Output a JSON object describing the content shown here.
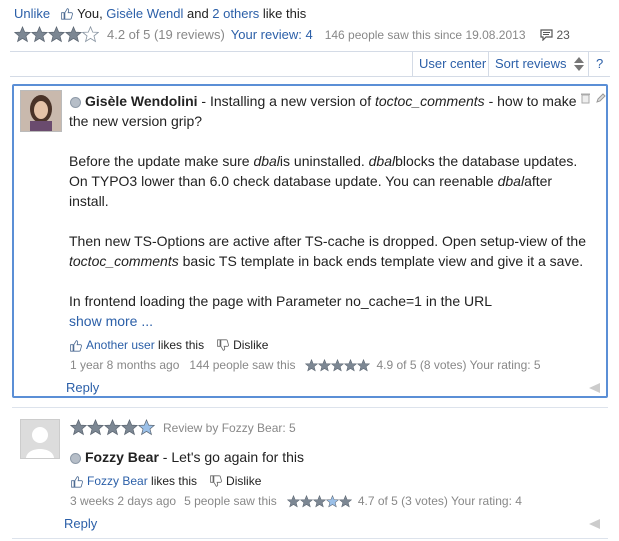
{
  "top": {
    "unlike": "Unlike",
    "like_you": "You, ",
    "like_person": "Gisèle Wendl",
    "like_and": " and ",
    "like_others": "2 others",
    "like_suffix": " like this",
    "rating_text": "4.2 of 5 (19 reviews)",
    "your_review": "Your review: 4",
    "seen_text": "146 people saw this since 19.08.2013",
    "comment_count": "23",
    "stars_value": 4.2
  },
  "sortbar": {
    "user_center": "User center",
    "sort_reviews": "Sort reviews",
    "help": "?"
  },
  "comment1": {
    "author": "Gisèle Wendolini",
    "title_prefix": " - Installing a new version of ",
    "title_em": "toctoc_comments",
    "title_suffix": " - how to make",
    "title_line2": "the new version grip?",
    "p1_a": "Before the update make sure ",
    "p1_em1": "dbal",
    "p1_b": "is uninstalled. ",
    "p1_em2": "dbal",
    "p1_c": "blocks the database updates.",
    "p1_line2_a": "On TYPO3 lower than 6.0 check database update. You can reenable ",
    "p1_em3": "dbal",
    "p1_line2_b": "after",
    "p1_line3": "install.",
    "p2_line1": "Then new TS-Options are active after TS-cache is dropped. Open setup-view of the",
    "p2_em": "toctoc_comments",
    "p2_line2": " basic TS template in back ends template view and give it a save.",
    "p3": "In frontend loading the page with Parameter no_cache=1 in the URL",
    "show_more": "show more ...",
    "liker": "Another user",
    "likes_suffix": " likes this",
    "dislike": "Dislike",
    "meta_time": "1 year 8 months ago",
    "meta_seen": "144 people saw this",
    "meta_rating": "4.9 of 5 (8 votes) Your rating: 5",
    "stars_value": 4.9,
    "reply": "Reply"
  },
  "comment2": {
    "review_by": "Review by Fozzy Bear: 5",
    "author": "Fozzy Bear",
    "text": " - Let's go again for this",
    "liker": "Fozzy Bear",
    "likes_suffix": " likes this",
    "dislike": "Dislike",
    "meta_time": "3 weeks 2 days ago",
    "meta_seen": "5 people saw this",
    "meta_rating": "4.7 of 5 (3 votes) Your rating: 4",
    "review_stars_value": 5,
    "stars_value": 4.7,
    "reply": "Reply"
  },
  "colors": {
    "link": "#2b5fa8",
    "active_border": "#5b8fd6",
    "star_fill": "#7c8793"
  },
  "icons": [
    "thumbs-up-icon",
    "thumbs-down-icon",
    "star-icon",
    "comment-bubble-icon",
    "sort-arrows-icon",
    "trash-icon",
    "edit-pencil-icon",
    "reply-arrow-icon",
    "online-dot-icon",
    "avatar-photo",
    "avatar-placeholder"
  ]
}
